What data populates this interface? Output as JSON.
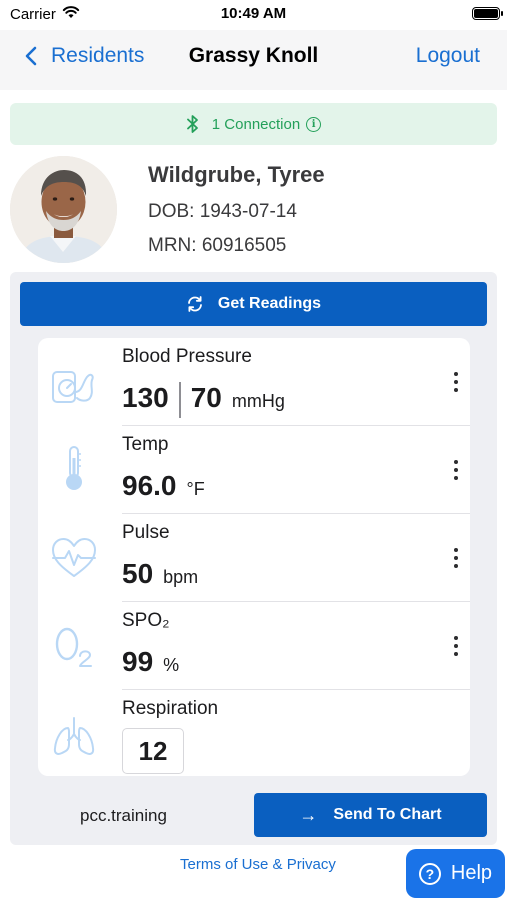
{
  "status_bar": {
    "carrier": "Carrier",
    "time": "10:49 AM"
  },
  "nav": {
    "back_label": "Residents",
    "title": "Grassy Knoll",
    "logout_label": "Logout"
  },
  "connection": {
    "text": "1 Connection"
  },
  "resident": {
    "name": "Wildgrube, Tyree",
    "dob": "DOB: 1943-07-14",
    "mrn": "MRN: 60916505"
  },
  "actions": {
    "get_readings": "Get Readings",
    "send_to_chart": "Send To Chart"
  },
  "vitals": {
    "blood_pressure": {
      "label": "Blood Pressure",
      "systolic": "130",
      "diastolic": "70",
      "unit": "mmHg",
      "icon": "blood-pressure-cuff-icon"
    },
    "temp": {
      "label": "Temp",
      "value": "96.0",
      "unit": "°F",
      "icon": "thermometer-icon"
    },
    "pulse": {
      "label": "Pulse",
      "value": "50",
      "unit": "bpm",
      "icon": "heartbeat-icon"
    },
    "spo2": {
      "label": "SPO₂",
      "value": "99",
      "unit": "%",
      "icon": "oxygen-icon"
    },
    "respiration": {
      "label": "Respiration",
      "value": "12",
      "icon": "lungs-icon"
    }
  },
  "footer": {
    "site": "pcc.training",
    "terms": "Terms of Use & Privacy",
    "help": "Help"
  },
  "colors": {
    "accent": "#0a5fc0",
    "link": "#1a6fd1",
    "connection_bg": "#e3f4ea",
    "connection_text": "#24a05a",
    "icon_tint": "#b9d7f5"
  }
}
